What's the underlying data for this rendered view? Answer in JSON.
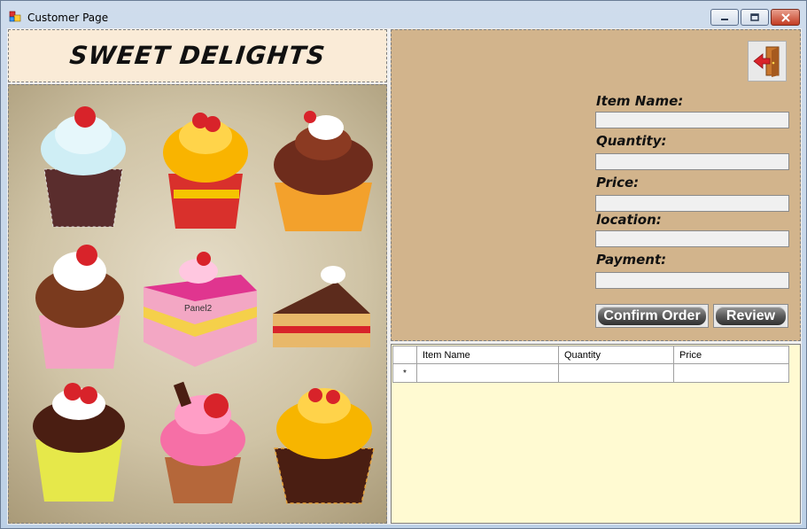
{
  "window": {
    "title": "Customer Page",
    "controls": {
      "minimize": "minimize-icon",
      "maximize": "maximize-icon",
      "close": "close-icon"
    }
  },
  "header": {
    "brand": "SWEET DELIGHTS"
  },
  "image_panel": {
    "label": "Panel2",
    "image": "cupcakes-illustration"
  },
  "form": {
    "exit_icon": "exit-door-icon",
    "fields": [
      {
        "label": "Item Name:",
        "value": ""
      },
      {
        "label": "Quantity:",
        "value": ""
      },
      {
        "label": "Price:",
        "value": ""
      },
      {
        "label": "location:",
        "value": ""
      },
      {
        "label": "Payment:",
        "value": ""
      }
    ],
    "confirm_label": "Confirm Order",
    "review_label": "Review"
  },
  "grid": {
    "columns": [
      "Item Name",
      "Quantity",
      "Price"
    ],
    "new_row_marker": "*",
    "background": "#fffad2"
  },
  "colors": {
    "form_background": "#d2b48c",
    "header_background": "#faebd7"
  }
}
